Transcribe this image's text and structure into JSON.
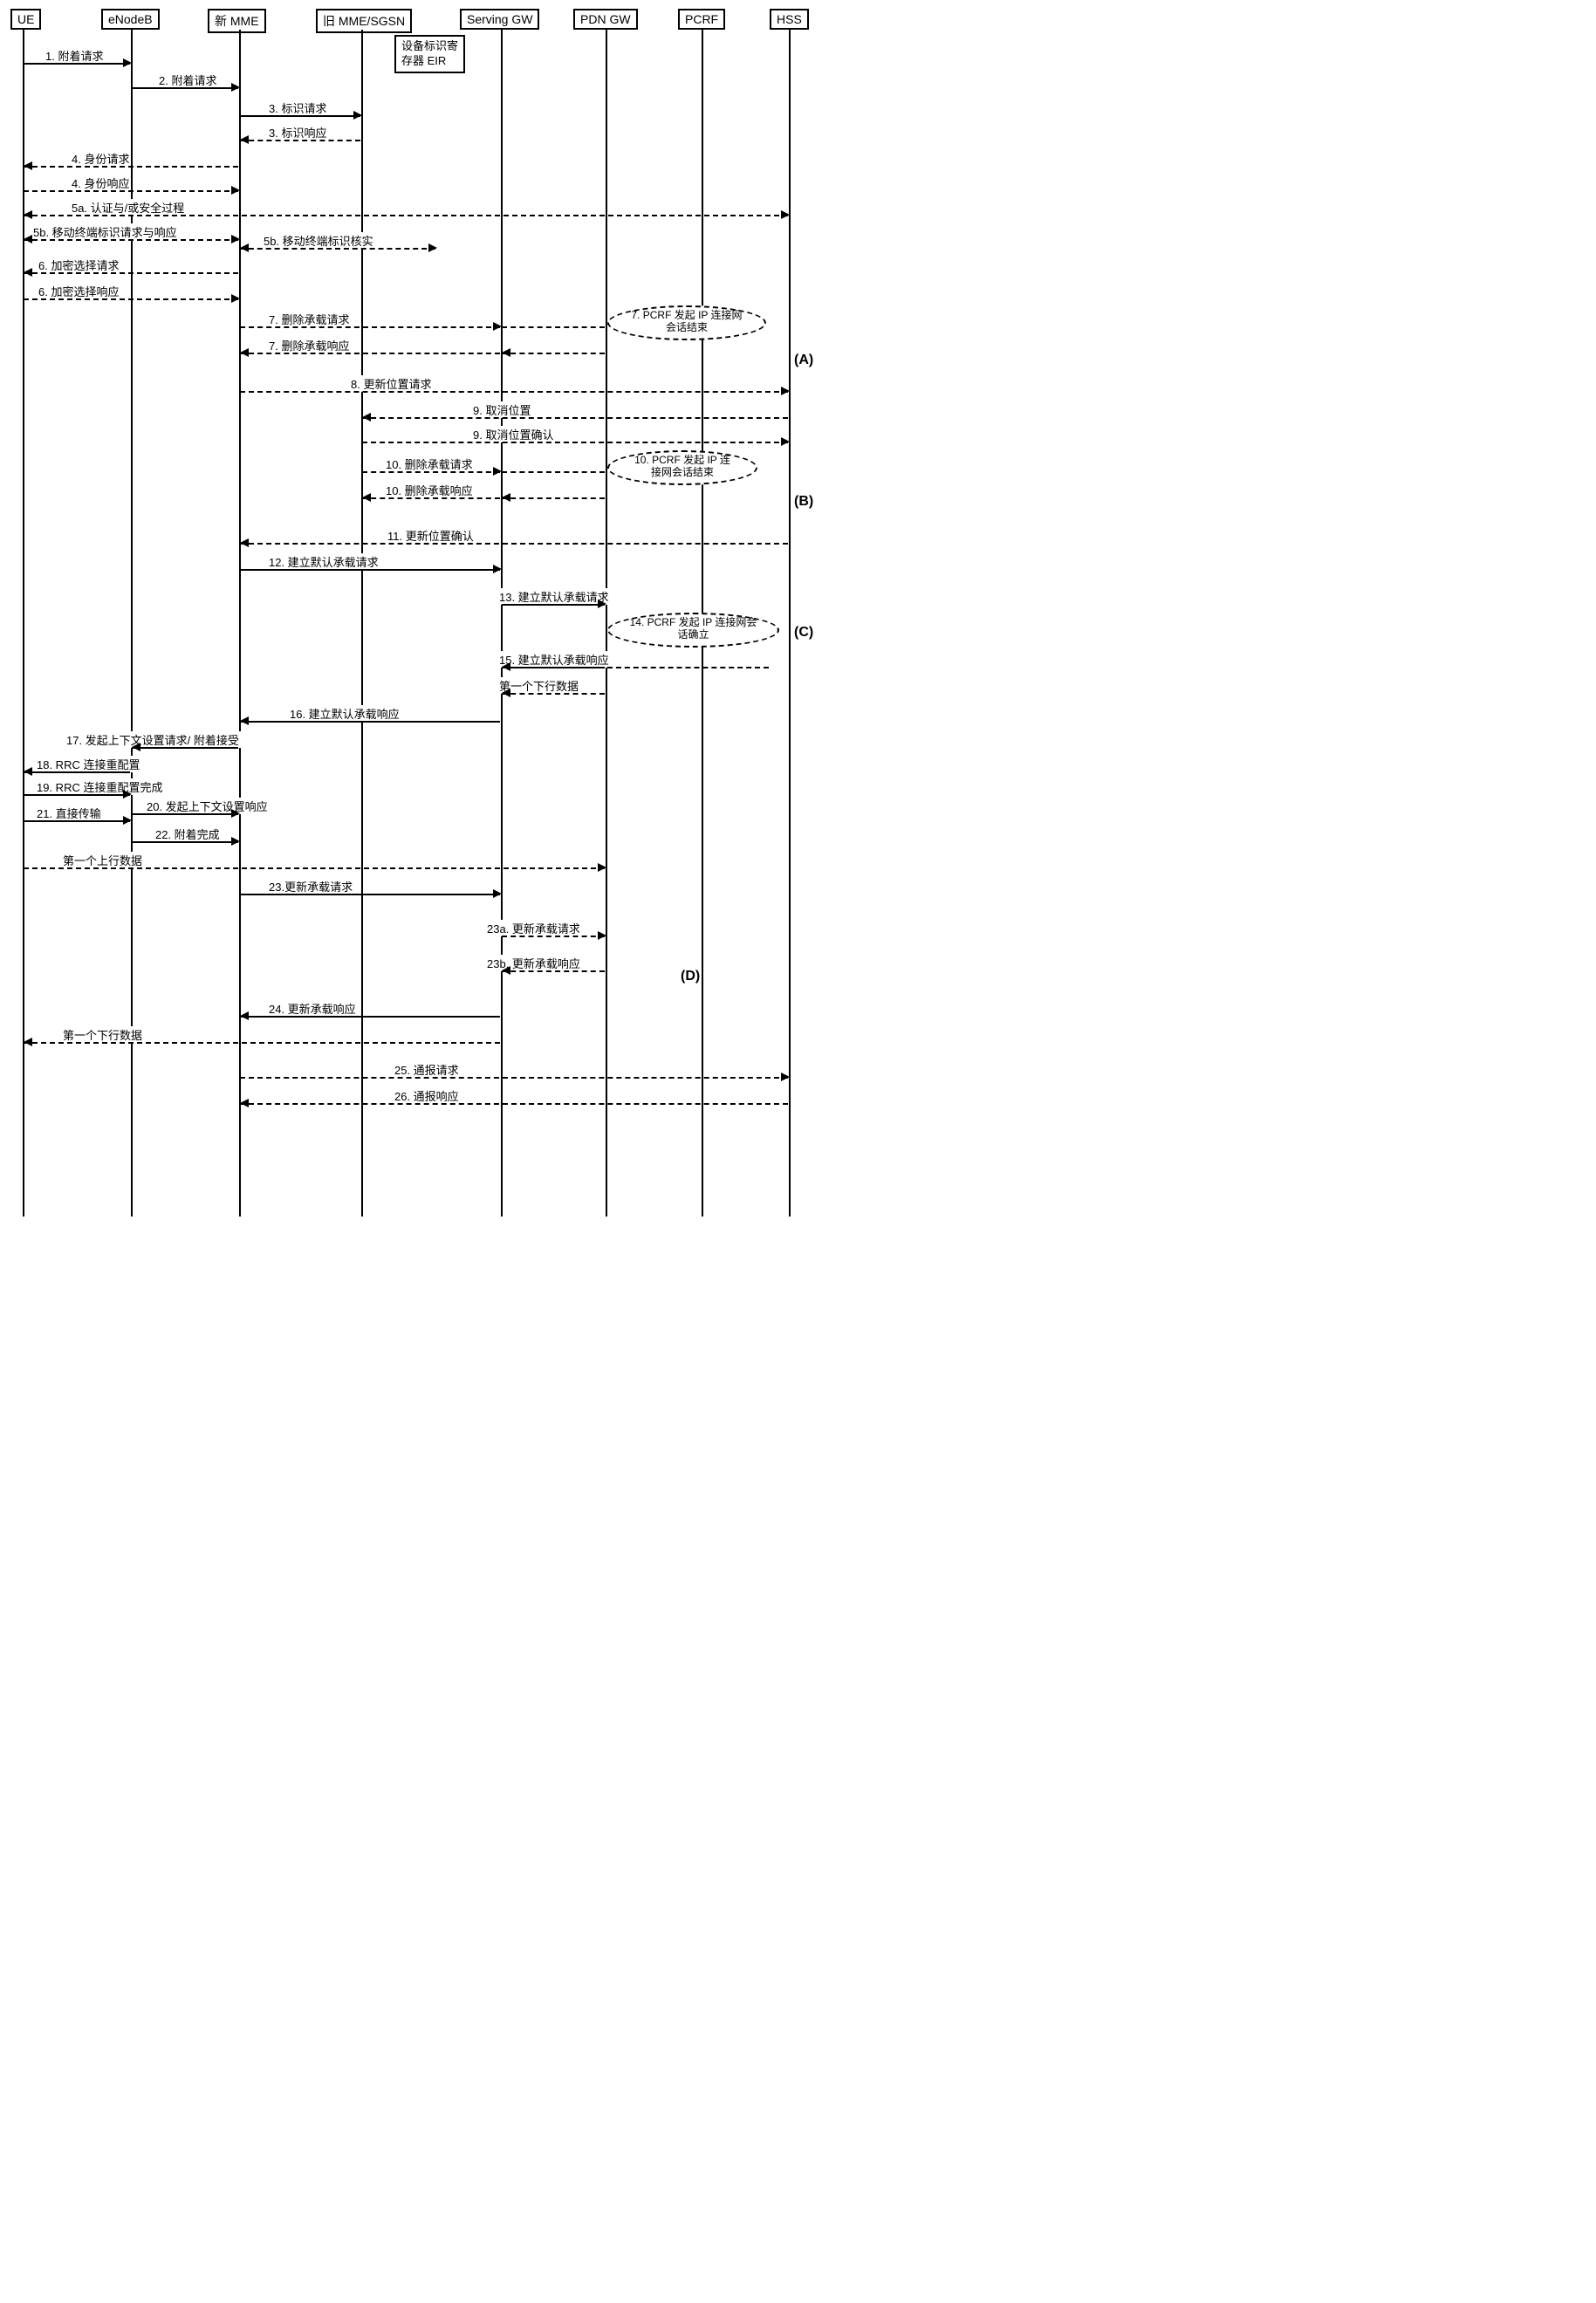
{
  "actors": {
    "ue": "UE",
    "enodeb": "eNodeB",
    "newmme": "新 MME",
    "oldmme": "旧 MME/SGSN",
    "sgw": "Serving GW",
    "pdngw": "PDN GW",
    "pcrf": "PCRF",
    "hss": "HSS"
  },
  "note_eir_l1": "设备标识寄",
  "note_eir_l2": "存器 EIR",
  "messages": {
    "m1": "1. 附着请求",
    "m2": "2. 附着请求",
    "m3a": "3. 标识请求",
    "m3b": "3. 标识响应",
    "m4a": "4. 身份请求",
    "m4b": "4. 身份响应",
    "m5a": "5a. 认证与/或安全过程",
    "m5b": "5b. 移动终端标识请求与响应",
    "m5b2": "5b. 移动终端标识核实",
    "m6a": "6. 加密选择请求",
    "m6b": "6. 加密选择响应",
    "m7a": "7. 删除承载请求",
    "m7b": "7. 删除承载响应",
    "m7c_l1": "7. PCRF 发起 IP 连接网",
    "m7c_l2": "会话结束",
    "m8": "8. 更新位置请求",
    "m9a": "9. 取消位置",
    "m9b": "9. 取消位置确认",
    "m10a": "10. 删除承载请求",
    "m10b": "10. 删除承载响应",
    "m10c_l1": "10. PCRF 发起 IP 连",
    "m10c_l2": "接网会话结束",
    "m11": "11. 更新位置确认",
    "m12": "12. 建立默认承载请求",
    "m13": "13. 建立默认承载请求",
    "m14_l1": "14. PCRF 发起 IP 连接网会",
    "m14_l2": "话确立",
    "m15": "15. 建立默认承载响应",
    "m16": "16. 建立默认承载响应",
    "m17": "17. 发起上下文设置请求/ 附着接受",
    "m18": "18. RRC 连接重配置",
    "m19": "19. RRC 连接重配置完成",
    "m20": "20. 发起上下文设置响应",
    "m21": "21. 直接传输",
    "m22": "22. 附着完成",
    "m23": "23.更新承载请求",
    "m23a": "23a. 更新承载请求",
    "m23b": "23b. 更新承载响应",
    "m24": "24. 更新承载响应",
    "m25": "25. 通报请求",
    "m26": "26. 通报响应",
    "firstDL1": "第一个下行数据",
    "firstUL": "第一个上行数据",
    "firstDL2": "第一个下行数据"
  },
  "phases": {
    "a": "(A)",
    "b": "(B)",
    "c": "(C)",
    "d": "(D)"
  }
}
